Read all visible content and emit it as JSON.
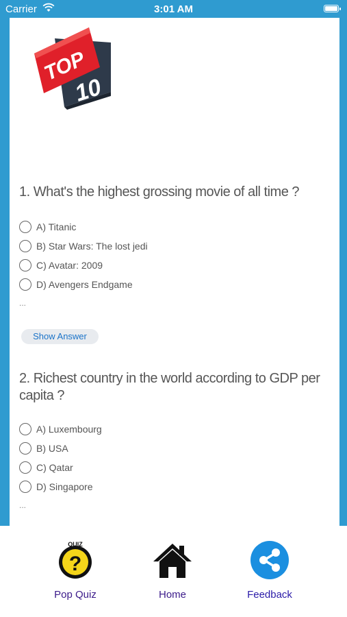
{
  "status": {
    "carrier": "Carrier",
    "time": "3:01 AM"
  },
  "logo": {
    "line1": "TOP",
    "line2": "10"
  },
  "questions": [
    {
      "text": "1. What's the highest grossing movie of all time ?",
      "options": [
        "A) Titanic",
        "B) Star Wars: The lost jedi",
        "C) Avatar: 2009",
        "D) Avengers Endgame"
      ],
      "ellipsis": "...",
      "show_answer_label": "Show Answer"
    },
    {
      "text": "2. Richest country in the world according to GDP per capita ?",
      "options": [
        "A) Luxembourg",
        "B) USA",
        "C) Qatar",
        "D) Singapore"
      ],
      "ellipsis": "..."
    }
  ],
  "tabs": [
    {
      "label": "Pop Quiz",
      "icon": "quiz-icon",
      "color": "#3b1a8a"
    },
    {
      "label": "Home",
      "icon": "home-icon",
      "color": "#3b1a8a"
    },
    {
      "label": "Feedback",
      "icon": "share-icon",
      "color": "#2a1aa8"
    }
  ],
  "colors": {
    "background": "#2f9bd0",
    "accent": "#1a73c8",
    "logo_red": "#e0202a",
    "logo_dark": "#2e3a4a"
  }
}
